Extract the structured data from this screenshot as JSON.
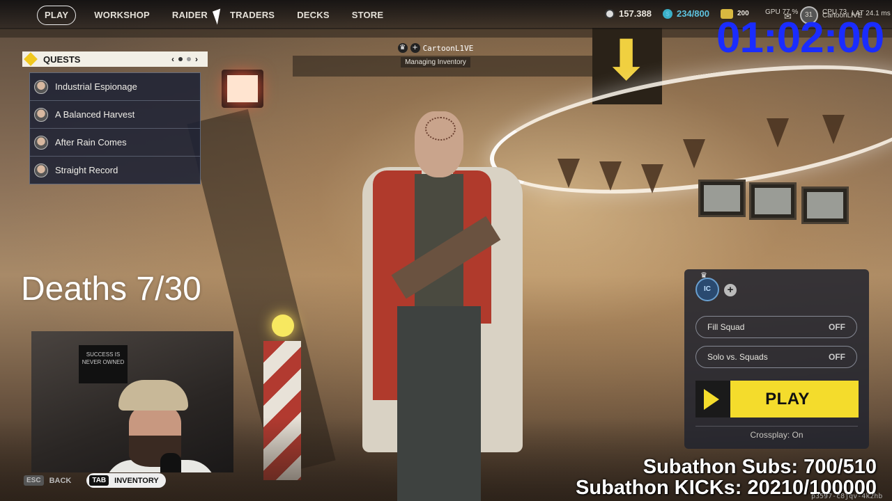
{
  "nav": {
    "items": [
      "PLAY",
      "WORKSHOP",
      "RAIDER",
      "TRADERS",
      "DECKS",
      "STORE"
    ],
    "active": "PLAY"
  },
  "currency": {
    "coins": "157.388",
    "raider_tokens": "234/800",
    "gold_value": "200"
  },
  "hud": {
    "gpu": "GPU 77 %",
    "cpu": "CPU 73",
    "fps": "31",
    "player": "CartoonLIVE",
    "latency": "LAT 24.1 ms"
  },
  "timer": "01:02:00",
  "player_tag": {
    "name": "CartoonL1VE",
    "status": "Managing Inventory"
  },
  "quests": {
    "title": "QUESTS",
    "items": [
      "Industrial Espionage",
      "A Balanced Harvest",
      "After Rain Comes",
      "Straight Record"
    ]
  },
  "deaths": "Deaths 7/30",
  "hints": {
    "back_key": "ESC",
    "back_label": "BACK",
    "inventory_key": "TAB",
    "inventory_label": "INVENTORY"
  },
  "play_panel": {
    "badge": "IC",
    "fill_squad_label": "Fill Squad",
    "fill_squad_value": "OFF",
    "solo_label": "Solo vs. Squads",
    "solo_value": "OFF",
    "play_label": "PLAY",
    "crossplay": "Crossplay: On"
  },
  "overlay": {
    "subs": "Subathon Subs: 700/510",
    "kicks": "Subathon KICKs: 20210/100000",
    "room_code": "p3597-c8jqv-4k2hb"
  },
  "webcam": {
    "poster_text": "SUCCESS IS NEVER OWNED"
  },
  "colors": {
    "accent_yellow": "#f4dc2c",
    "timer_blue": "#1a2cff",
    "panel_bg": "#22242e"
  }
}
